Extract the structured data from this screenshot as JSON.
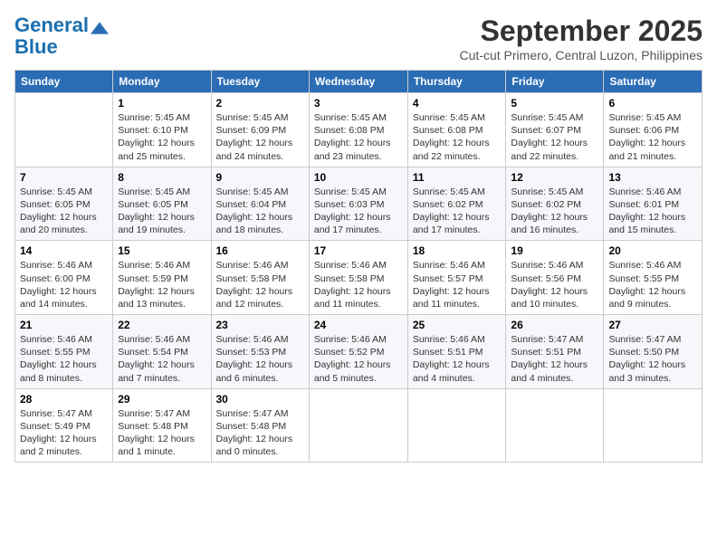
{
  "logo": {
    "line1": "General",
    "line2": "Blue"
  },
  "title": "September 2025",
  "subtitle": "Cut-cut Primero, Central Luzon, Philippines",
  "headers": [
    "Sunday",
    "Monday",
    "Tuesday",
    "Wednesday",
    "Thursday",
    "Friday",
    "Saturday"
  ],
  "weeks": [
    [
      {
        "day": "",
        "lines": []
      },
      {
        "day": "1",
        "lines": [
          "Sunrise: 5:45 AM",
          "Sunset: 6:10 PM",
          "Daylight: 12 hours",
          "and 25 minutes."
        ]
      },
      {
        "day": "2",
        "lines": [
          "Sunrise: 5:45 AM",
          "Sunset: 6:09 PM",
          "Daylight: 12 hours",
          "and 24 minutes."
        ]
      },
      {
        "day": "3",
        "lines": [
          "Sunrise: 5:45 AM",
          "Sunset: 6:08 PM",
          "Daylight: 12 hours",
          "and 23 minutes."
        ]
      },
      {
        "day": "4",
        "lines": [
          "Sunrise: 5:45 AM",
          "Sunset: 6:08 PM",
          "Daylight: 12 hours",
          "and 22 minutes."
        ]
      },
      {
        "day": "5",
        "lines": [
          "Sunrise: 5:45 AM",
          "Sunset: 6:07 PM",
          "Daylight: 12 hours",
          "and 22 minutes."
        ]
      },
      {
        "day": "6",
        "lines": [
          "Sunrise: 5:45 AM",
          "Sunset: 6:06 PM",
          "Daylight: 12 hours",
          "and 21 minutes."
        ]
      }
    ],
    [
      {
        "day": "7",
        "lines": [
          "Sunrise: 5:45 AM",
          "Sunset: 6:05 PM",
          "Daylight: 12 hours",
          "and 20 minutes."
        ]
      },
      {
        "day": "8",
        "lines": [
          "Sunrise: 5:45 AM",
          "Sunset: 6:05 PM",
          "Daylight: 12 hours",
          "and 19 minutes."
        ]
      },
      {
        "day": "9",
        "lines": [
          "Sunrise: 5:45 AM",
          "Sunset: 6:04 PM",
          "Daylight: 12 hours",
          "and 18 minutes."
        ]
      },
      {
        "day": "10",
        "lines": [
          "Sunrise: 5:45 AM",
          "Sunset: 6:03 PM",
          "Daylight: 12 hours",
          "and 17 minutes."
        ]
      },
      {
        "day": "11",
        "lines": [
          "Sunrise: 5:45 AM",
          "Sunset: 6:02 PM",
          "Daylight: 12 hours",
          "and 17 minutes."
        ]
      },
      {
        "day": "12",
        "lines": [
          "Sunrise: 5:45 AM",
          "Sunset: 6:02 PM",
          "Daylight: 12 hours",
          "and 16 minutes."
        ]
      },
      {
        "day": "13",
        "lines": [
          "Sunrise: 5:46 AM",
          "Sunset: 6:01 PM",
          "Daylight: 12 hours",
          "and 15 minutes."
        ]
      }
    ],
    [
      {
        "day": "14",
        "lines": [
          "Sunrise: 5:46 AM",
          "Sunset: 6:00 PM",
          "Daylight: 12 hours",
          "and 14 minutes."
        ]
      },
      {
        "day": "15",
        "lines": [
          "Sunrise: 5:46 AM",
          "Sunset: 5:59 PM",
          "Daylight: 12 hours",
          "and 13 minutes."
        ]
      },
      {
        "day": "16",
        "lines": [
          "Sunrise: 5:46 AM",
          "Sunset: 5:58 PM",
          "Daylight: 12 hours",
          "and 12 minutes."
        ]
      },
      {
        "day": "17",
        "lines": [
          "Sunrise: 5:46 AM",
          "Sunset: 5:58 PM",
          "Daylight: 12 hours",
          "and 11 minutes."
        ]
      },
      {
        "day": "18",
        "lines": [
          "Sunrise: 5:46 AM",
          "Sunset: 5:57 PM",
          "Daylight: 12 hours",
          "and 11 minutes."
        ]
      },
      {
        "day": "19",
        "lines": [
          "Sunrise: 5:46 AM",
          "Sunset: 5:56 PM",
          "Daylight: 12 hours",
          "and 10 minutes."
        ]
      },
      {
        "day": "20",
        "lines": [
          "Sunrise: 5:46 AM",
          "Sunset: 5:55 PM",
          "Daylight: 12 hours",
          "and 9 minutes."
        ]
      }
    ],
    [
      {
        "day": "21",
        "lines": [
          "Sunrise: 5:46 AM",
          "Sunset: 5:55 PM",
          "Daylight: 12 hours",
          "and 8 minutes."
        ]
      },
      {
        "day": "22",
        "lines": [
          "Sunrise: 5:46 AM",
          "Sunset: 5:54 PM",
          "Daylight: 12 hours",
          "and 7 minutes."
        ]
      },
      {
        "day": "23",
        "lines": [
          "Sunrise: 5:46 AM",
          "Sunset: 5:53 PM",
          "Daylight: 12 hours",
          "and 6 minutes."
        ]
      },
      {
        "day": "24",
        "lines": [
          "Sunrise: 5:46 AM",
          "Sunset: 5:52 PM",
          "Daylight: 12 hours",
          "and 5 minutes."
        ]
      },
      {
        "day": "25",
        "lines": [
          "Sunrise: 5:46 AM",
          "Sunset: 5:51 PM",
          "Daylight: 12 hours",
          "and 4 minutes."
        ]
      },
      {
        "day": "26",
        "lines": [
          "Sunrise: 5:47 AM",
          "Sunset: 5:51 PM",
          "Daylight: 12 hours",
          "and 4 minutes."
        ]
      },
      {
        "day": "27",
        "lines": [
          "Sunrise: 5:47 AM",
          "Sunset: 5:50 PM",
          "Daylight: 12 hours",
          "and 3 minutes."
        ]
      }
    ],
    [
      {
        "day": "28",
        "lines": [
          "Sunrise: 5:47 AM",
          "Sunset: 5:49 PM",
          "Daylight: 12 hours",
          "and 2 minutes."
        ]
      },
      {
        "day": "29",
        "lines": [
          "Sunrise: 5:47 AM",
          "Sunset: 5:48 PM",
          "Daylight: 12 hours",
          "and 1 minute."
        ]
      },
      {
        "day": "30",
        "lines": [
          "Sunrise: 5:47 AM",
          "Sunset: 5:48 PM",
          "Daylight: 12 hours",
          "and 0 minutes."
        ]
      },
      {
        "day": "",
        "lines": []
      },
      {
        "day": "",
        "lines": []
      },
      {
        "day": "",
        "lines": []
      },
      {
        "day": "",
        "lines": []
      }
    ]
  ]
}
